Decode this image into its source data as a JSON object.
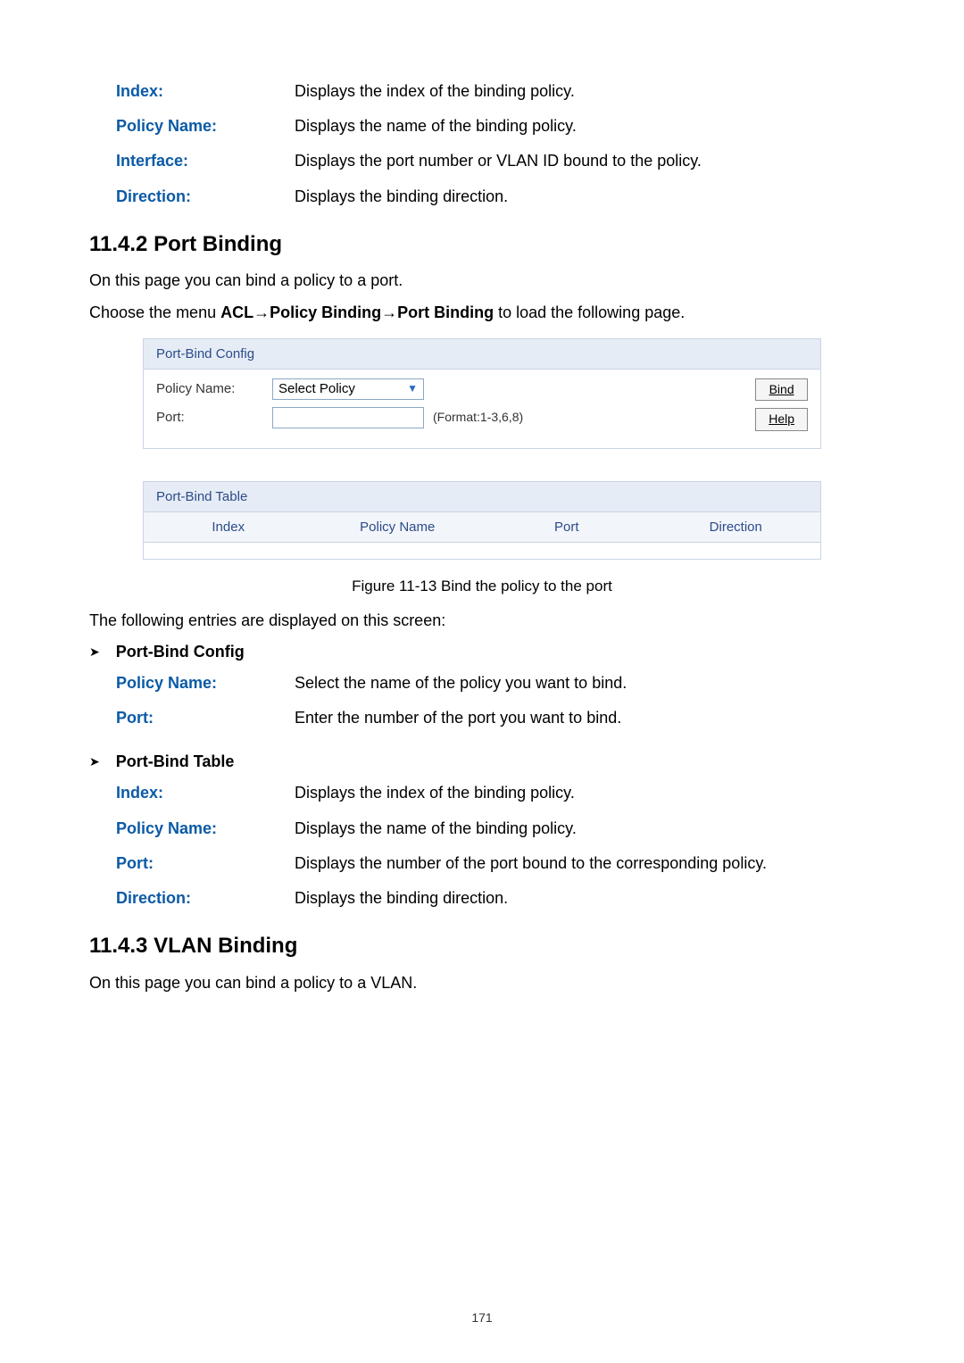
{
  "top_def": {
    "index_label": "Index:",
    "index_desc": "Displays the index of the binding policy.",
    "policy_name_label": "Policy Name:",
    "policy_name_desc": "Displays the name of the binding policy.",
    "interface_label": "Interface:",
    "interface_desc": "Displays the port number or VLAN ID bound to the policy.",
    "direction_label": "Direction:",
    "direction_desc": "Displays the binding direction."
  },
  "sect_11_4_2": {
    "heading": "11.4.2  Port Binding",
    "intro": "On this page you can bind a policy to a port.",
    "menu_prefix": "Choose the menu ",
    "menu_acl": "ACL",
    "menu_arrow1": "→",
    "menu_pb": "Policy Binding",
    "menu_arrow2": "→",
    "menu_port": "Port Binding",
    "menu_suffix": " to load the following page."
  },
  "ui1": {
    "config_title": "Port-Bind Config",
    "policy_label": "Policy Name:",
    "policy_select": "Select Policy",
    "port_label": "Port:",
    "format_hint": "(Format:1-3,6,8)",
    "btn_bind": "Bind",
    "btn_help": "Help",
    "table_title": "Port-Bind Table",
    "col_index": "Index",
    "col_policy": "Policy Name",
    "col_port": "Port",
    "col_direction": "Direction"
  },
  "fig_caption": "Figure 11-13 Bind the policy to the port",
  "entries_intro": "The following entries are displayed on this screen:",
  "bullet_config": "Port-Bind Config",
  "config_def": {
    "policy_label": "Policy Name:",
    "policy_desc": "Select the name of the policy you want to bind.",
    "port_label": "Port:",
    "port_desc": "Enter the number of the port you want to bind."
  },
  "bullet_table": "Port-Bind Table",
  "table_def": {
    "index_label": "Index:",
    "index_desc": "Displays the index of the binding policy.",
    "policy_label": "Policy Name:",
    "policy_desc": "Displays the name of the binding policy.",
    "port_label": "Port:",
    "port_desc": "Displays the number of the port bound to the corresponding policy.",
    "direction_label": "Direction:",
    "direction_desc": "Displays the binding direction."
  },
  "sect_11_4_3": {
    "heading": "11.4.3  VLAN Binding",
    "intro": "On this page you can bind a policy to a VLAN."
  },
  "page_number": "171"
}
